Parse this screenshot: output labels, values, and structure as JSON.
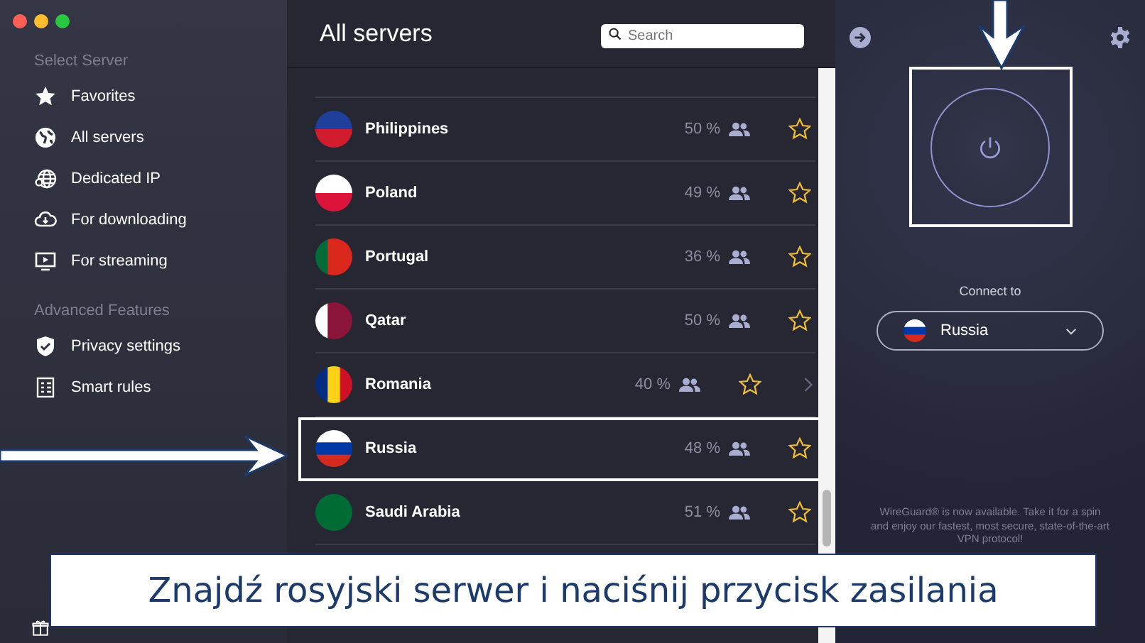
{
  "sidebar": {
    "sections": [
      {
        "heading": "Select Server",
        "items": [
          {
            "label": "Favorites"
          },
          {
            "label": "All servers"
          },
          {
            "label": "Dedicated IP"
          },
          {
            "label": "For downloading"
          },
          {
            "label": "For streaming"
          }
        ]
      },
      {
        "heading": "Advanced Features",
        "items": [
          {
            "label": "Privacy settings"
          },
          {
            "label": "Smart rules"
          }
        ]
      }
    ]
  },
  "list": {
    "title": "All servers",
    "search": {
      "placeholder": "Search"
    },
    "rows": [
      {
        "name": "Philippines",
        "load": "50 %",
        "favorite": false,
        "revealed": false,
        "highlighted": false
      },
      {
        "name": "Poland",
        "load": "49 %",
        "favorite": false,
        "revealed": false,
        "highlighted": false
      },
      {
        "name": "Portugal",
        "load": "36 %",
        "favorite": false,
        "revealed": false,
        "highlighted": false
      },
      {
        "name": "Qatar",
        "load": "50 %",
        "favorite": false,
        "revealed": false,
        "highlighted": false
      },
      {
        "name": "Romania",
        "load": "40 %",
        "favorite": false,
        "revealed": true,
        "highlighted": false
      },
      {
        "name": "Russia",
        "load": "48 %",
        "favorite": false,
        "revealed": false,
        "highlighted": true
      },
      {
        "name": "Saudi Arabia",
        "load": "51 %",
        "favorite": false,
        "revealed": false,
        "highlighted": false
      }
    ]
  },
  "panel": {
    "power": {
      "highlighted": true
    },
    "connect_label": "Connect to",
    "location": {
      "name": "Russia"
    },
    "notice": "WireGuard® is now available. Take it for a spin and enjoy our fastest, most secure, state-of-the-art VPN protocol!"
  },
  "caption": "Znajdź rosyjski serwer i naciśnij przycisk zasilania"
}
